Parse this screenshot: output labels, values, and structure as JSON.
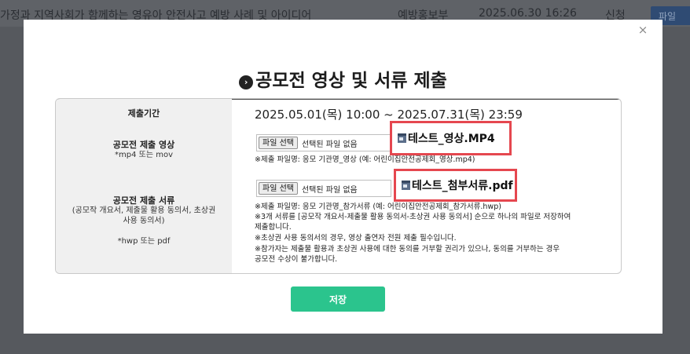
{
  "background": {
    "title": "가정과 지역사회가 함께하는 영유아 안전사고 예방 사례 및 아이디어",
    "dept": "예방홍보부",
    "date": "2025.06.30 16:26",
    "status": "신청",
    "button": "파일"
  },
  "modal": {
    "close_icon": "×",
    "title": "공모전 영상 및 서류 제출",
    "title_icon": "chevron-right-circle-icon",
    "period_label": "제출기간",
    "period_value": "2025.05.01(목) 10:00 ~ 2025.07.31(목) 23:59",
    "video_label": "공모전 제출 영상",
    "video_sub": "*mp4 또는 mov",
    "video_file_button": "파일 선택",
    "video_file_status": "선택된 파일 없음",
    "video_sample": "테스트_영상.MP4",
    "video_note": "※제출 파일명: 응모 기관명_영상 (예: 어린이집안전공제회_영상.mp4)",
    "docs_label": "공모전 제출 서류",
    "docs_sub1": "(공모작 개요서, 제출물 활용 동의서, 초상권",
    "docs_sub2": "사용 동의서)",
    "docs_sub3": "*hwp 또는 pdf",
    "docs_file_button": "파일 선택",
    "docs_file_status": "선택된 파일 없음",
    "docs_sample": "테스트_첨부서류.pdf",
    "docs_notes": [
      "※제출 파일명: 응모 기관명_참가서류 (예: 어린이집안전공제회_참가서류.hwp)",
      "※3개 서류를 [공모작 개요서-제출물 활용 동의서-초상권 사용 동의서] 순으로 하나의 파일로 저장하여",
      "제출합니다.",
      "※초상권 사용 동의서의 경우, 영상 출연자 전원 제출 필수입니다.",
      "※참가자는 제출물 활용과 초상권 사용에 대한 동의를 거부할 권리가 있으나, 동의를 거부하는 경우",
      "공모전 수상이 불가합니다."
    ],
    "save_label": "저장"
  },
  "colors": {
    "accent": "#2bc48d",
    "highlight_border": "#e5474f",
    "overlay": "#5a5d62"
  }
}
